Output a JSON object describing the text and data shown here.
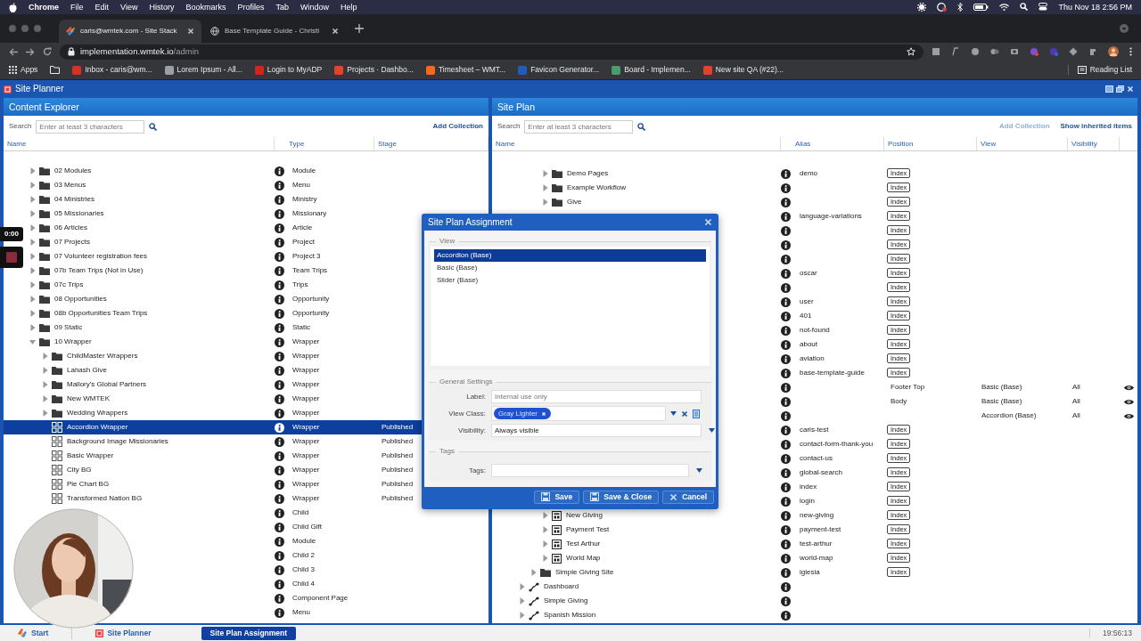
{
  "menubar": {
    "app": "Chrome",
    "menus": [
      "File",
      "Edit",
      "View",
      "History",
      "Bookmarks",
      "Profiles",
      "Tab",
      "Window",
      "Help"
    ],
    "clock": "Thu Nov 18  2:56 PM"
  },
  "browser": {
    "tabs": [
      {
        "title": "caris@wmtek.com - Site Stack",
        "selected": true
      },
      {
        "title": "Base Template Guide - Christi",
        "selected": false
      }
    ],
    "url_host": "implementation.wmtek.io",
    "url_path": "/admin",
    "bookmarks": [
      {
        "kind": "apps",
        "label": "Apps"
      },
      {
        "kind": "folder"
      },
      {
        "kind": "site",
        "label": "Inbox - caris@wm...",
        "color": "#d93025"
      },
      {
        "kind": "site",
        "label": "Lorem Ipsum - All...",
        "color": "#9aa0a6"
      },
      {
        "kind": "site",
        "label": "Login to MyADP",
        "color": "#d0271d"
      },
      {
        "kind": "site",
        "label": "Projects · Dashbo...",
        "color": "#e2432a"
      },
      {
        "kind": "site",
        "label": "Timesheet – WMT...",
        "color": "#f26b1d"
      },
      {
        "kind": "site",
        "label": "Favicon Generator...",
        "color": "#1e5cbf"
      },
      {
        "kind": "site",
        "label": "Board - Implemen...",
        "color": "#4a9c6d"
      },
      {
        "kind": "site",
        "label": "New site QA (#22)...",
        "color": "#e2432a"
      }
    ],
    "reading_list": "Reading List"
  },
  "app": {
    "title": "Site Planner"
  },
  "left": {
    "title": "Content Explorer",
    "search_label": "Search",
    "search_placeholder": "Enter at least 3 characters",
    "actions": [
      {
        "label": "Add Collection",
        "disabled": false
      }
    ],
    "columns": [
      "Name",
      "Type",
      "Stage"
    ],
    "tree": [
      {
        "children": [
          {
            "name": "02 Modules",
            "type": "Module",
            "kind": "folder",
            "expanded": false,
            "selected": false
          },
          {
            "name": "03 Menus",
            "type": "Menu",
            "kind": "folder",
            "expanded": false,
            "selected": false
          },
          {
            "name": "04 Ministries",
            "type": "Ministry",
            "kind": "folder",
            "expanded": false,
            "selected": false
          },
          {
            "name": "05 Missionaries",
            "type": "Missionary",
            "kind": "folder",
            "expanded": false,
            "selected": false
          },
          {
            "name": "06 Articles",
            "type": "Article",
            "kind": "folder",
            "expanded": false,
            "selected": false
          },
          {
            "name": "07 Projects",
            "type": "Project",
            "kind": "folder",
            "expanded": false,
            "selected": false
          },
          {
            "name": "07 Volunteer registration fees",
            "type": "Project 3",
            "kind": "folder",
            "expanded": false,
            "selected": false
          },
          {
            "name": "07b Team Trips (Not in Use)",
            "type": "Team Trips",
            "kind": "folder",
            "expanded": false,
            "selected": false
          },
          {
            "name": "07c Trips",
            "type": "Trips",
            "kind": "folder",
            "expanded": false,
            "selected": false
          },
          {
            "name": "08 Opportunities",
            "type": "Opportunity",
            "kind": "folder",
            "expanded": false,
            "selected": false
          },
          {
            "name": "08b Opportunities Team Trips",
            "type": "Opportunity",
            "kind": "folder",
            "expanded": false,
            "selected": false
          },
          {
            "name": "09 Static",
            "type": "Static",
            "kind": "folder",
            "expanded": false,
            "selected": false
          },
          {
            "name": "10 Wrapper",
            "type": "Wrapper",
            "kind": "folder",
            "expanded": true,
            "selected": false,
            "children": [
              {
                "name": "ChildMaster Wrappers",
                "type": "Wrapper",
                "kind": "folder",
                "expanded": false,
                "selected": false
              },
              {
                "name": "Lahash Give",
                "type": "Wrapper",
                "kind": "folder",
                "expanded": false,
                "selected": false
              },
              {
                "name": "Mallory's Global Partners",
                "type": "Wrapper",
                "kind": "folder",
                "expanded": false,
                "selected": false
              },
              {
                "name": "New WMTEK",
                "type": "Wrapper",
                "kind": "folder",
                "expanded": false,
                "selected": false
              },
              {
                "name": "Wedding Wrappers",
                "type": "Wrapper",
                "kind": "folder",
                "expanded": false,
                "selected": false
              },
              {
                "name": "Accordion Wrapper",
                "type": "Wrapper",
                "stage": "Published",
                "kind": "wrapper",
                "selected": true
              },
              {
                "name": "Background Image Missionaries",
                "type": "Wrapper",
                "stage": "Published",
                "kind": "wrapper",
                "selected": false
              },
              {
                "name": "Basic Wrapper",
                "type": "Wrapper",
                "stage": "Published",
                "kind": "wrapper",
                "selected": false
              },
              {
                "name": "City BG",
                "type": "Wrapper",
                "stage": "Published",
                "kind": "wrapper",
                "selected": false
              },
              {
                "name": "Pie Chart BG",
                "type": "Wrapper",
                "stage": "Published",
                "kind": "wrapper",
                "selected": false
              },
              {
                "name": "Transformed Nation BG",
                "type": "Wrapper",
                "stage": "Published",
                "kind": "wrapper",
                "selected": false
              }
            ]
          },
          {
            "type": "Child",
            "selected": false
          },
          {
            "type": "Child Gift",
            "selected": false
          },
          {
            "type": "Module",
            "selected": false
          },
          {
            "type": "Child 2",
            "selected": false
          },
          {
            "type": "Child 3",
            "selected": false
          },
          {
            "type": "Child 4",
            "selected": false
          },
          {
            "type": "Component Page",
            "selected": false
          },
          {
            "type": "Menu",
            "selected": false
          }
        ]
      }
    ]
  },
  "right": {
    "title": "Site Plan",
    "search_label": "Search",
    "search_placeholder": "Enter at least 3 characters",
    "actions": [
      {
        "label": "Add Collection",
        "disabled": true
      },
      {
        "label": "Show inherited items",
        "disabled": false
      }
    ],
    "columns": [
      "Name",
      "Alias",
      "Position",
      "View",
      "Visibility"
    ],
    "tree": [
      {
        "children": [
          {
            "children": [
              {
                "name": "Demo Pages",
                "kind": "folder",
                "expanded": false,
                "alias": "demo",
                "index": "Index"
              },
              {
                "name": "Example Workflow",
                "kind": "folder",
                "expanded": false,
                "index": "Index"
              },
              {
                "name": "Give",
                "kind": "folder",
                "expanded": false,
                "index": "Index"
              },
              {
                "alias": "language-variations",
                "index": "Index"
              },
              {
                "index": "Index"
              },
              {
                "index": "Index"
              },
              {
                "index": "Index"
              },
              {
                "alias": "oscar",
                "index": "Index"
              },
              {
                "index": "Index"
              },
              {
                "alias": "user",
                "index": "Index"
              },
              {
                "alias": "401",
                "index": "Index"
              },
              {
                "alias": "not-found",
                "index": "Index"
              },
              {
                "alias": "about",
                "index": "Index"
              },
              {
                "alias": "aviation",
                "index": "Index"
              },
              {
                "alias": "base-template-guide",
                "index": "Index"
              },
              {
                "position": "Footer Top",
                "view": "Basic (Base)",
                "visibility": "All"
              },
              {
                "position": "Body",
                "view": "Basic (Base)",
                "visibility": "All"
              },
              {
                "view": "Accordion (Base)",
                "visibility": "All"
              },
              {
                "alias": "caris-test",
                "index": "Index"
              },
              {
                "alias": "contact-form-thank-you",
                "index": "Index"
              },
              {
                "alias": "contact-us",
                "index": "Index"
              },
              {
                "alias": "global-search",
                "index": "Index"
              },
              {
                "alias": "index",
                "index": "Index"
              },
              {
                "alias": "login",
                "index": "Index"
              },
              {
                "name": "New Giving",
                "kind": "page",
                "expanded": false,
                "alias": "new-giving",
                "index": "Index"
              },
              {
                "name": "Payment Test",
                "kind": "page",
                "expanded": false,
                "alias": "payment-test",
                "index": "Index"
              },
              {
                "name": "Test Arthur",
                "kind": "page",
                "expanded": false,
                "alias": "test-arthur",
                "index": "Index"
              },
              {
                "name": "World Map",
                "kind": "page",
                "expanded": false,
                "alias": "world-map",
                "index": "Index"
              }
            ]
          },
          {
            "name": "Simple Giving Site",
            "kind": "folder",
            "expanded": false,
            "alias": "iglesia",
            "index": "Index"
          }
        ]
      },
      {
        "name": "Dashboard",
        "kind": "route",
        "expanded": false
      },
      {
        "name": "Simple Giving",
        "kind": "route",
        "expanded": false
      },
      {
        "name": "Spanish Mission",
        "kind": "route",
        "expanded": false
      }
    ]
  },
  "dialog": {
    "title": "Site Plan Assignment",
    "view_legend": "View",
    "views": [
      {
        "label": "Accordion (Base)",
        "selected": true
      },
      {
        "label": "Basic (Base)",
        "selected": false
      },
      {
        "label": "Slider (Base)",
        "selected": false
      }
    ],
    "general_legend": "General Settings",
    "label_field": {
      "label": "Label:",
      "placeholder": "Internal use only"
    },
    "view_class": {
      "label": "View Class:",
      "tags": [
        "Gray Lighter"
      ]
    },
    "visibility": {
      "label": "Visibility:",
      "value": "Always visible"
    },
    "tags_legend": "Tags",
    "tags_field": {
      "label": "Tags:"
    },
    "buttons": [
      {
        "label": "Save",
        "kind": "save"
      },
      {
        "label": "Save & Close",
        "kind": "save"
      },
      {
        "label": "Cancel",
        "kind": "cancel"
      }
    ]
  },
  "recorder": {
    "timer": "0:00"
  },
  "taskbar": {
    "start": "Start",
    "items": [
      {
        "label": "Site Planner",
        "selected": false
      },
      {
        "label": "Site Plan Assignment",
        "selected": true
      }
    ],
    "clock": "19:56:13"
  }
}
